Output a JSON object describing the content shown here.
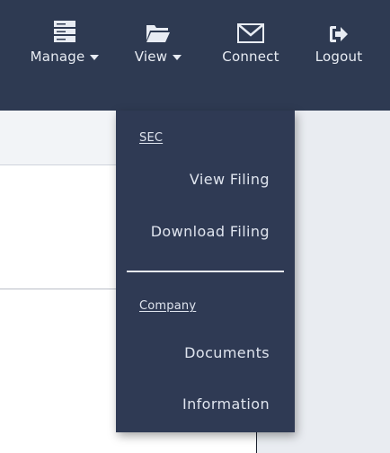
{
  "topnav": {
    "manage": {
      "label": "Manage",
      "icon": "server-icon"
    },
    "view": {
      "label": "View",
      "icon": "folder-open-icon"
    },
    "connect": {
      "label": "Connect",
      "icon": "envelope-icon"
    },
    "logout": {
      "label": "Logout",
      "icon": "sign-out-icon"
    }
  },
  "view_menu": {
    "sec_header": "SEC",
    "view_filing": "View Filing",
    "download_filing": "Download Filing",
    "company_header": "Company",
    "documents": "Documents",
    "information": "Information"
  },
  "colors": {
    "navbar": "#2e3a52",
    "dropdown": "#2f3a54",
    "text_light": "#e8ecf3",
    "page_bg": "#e9ecf1"
  }
}
